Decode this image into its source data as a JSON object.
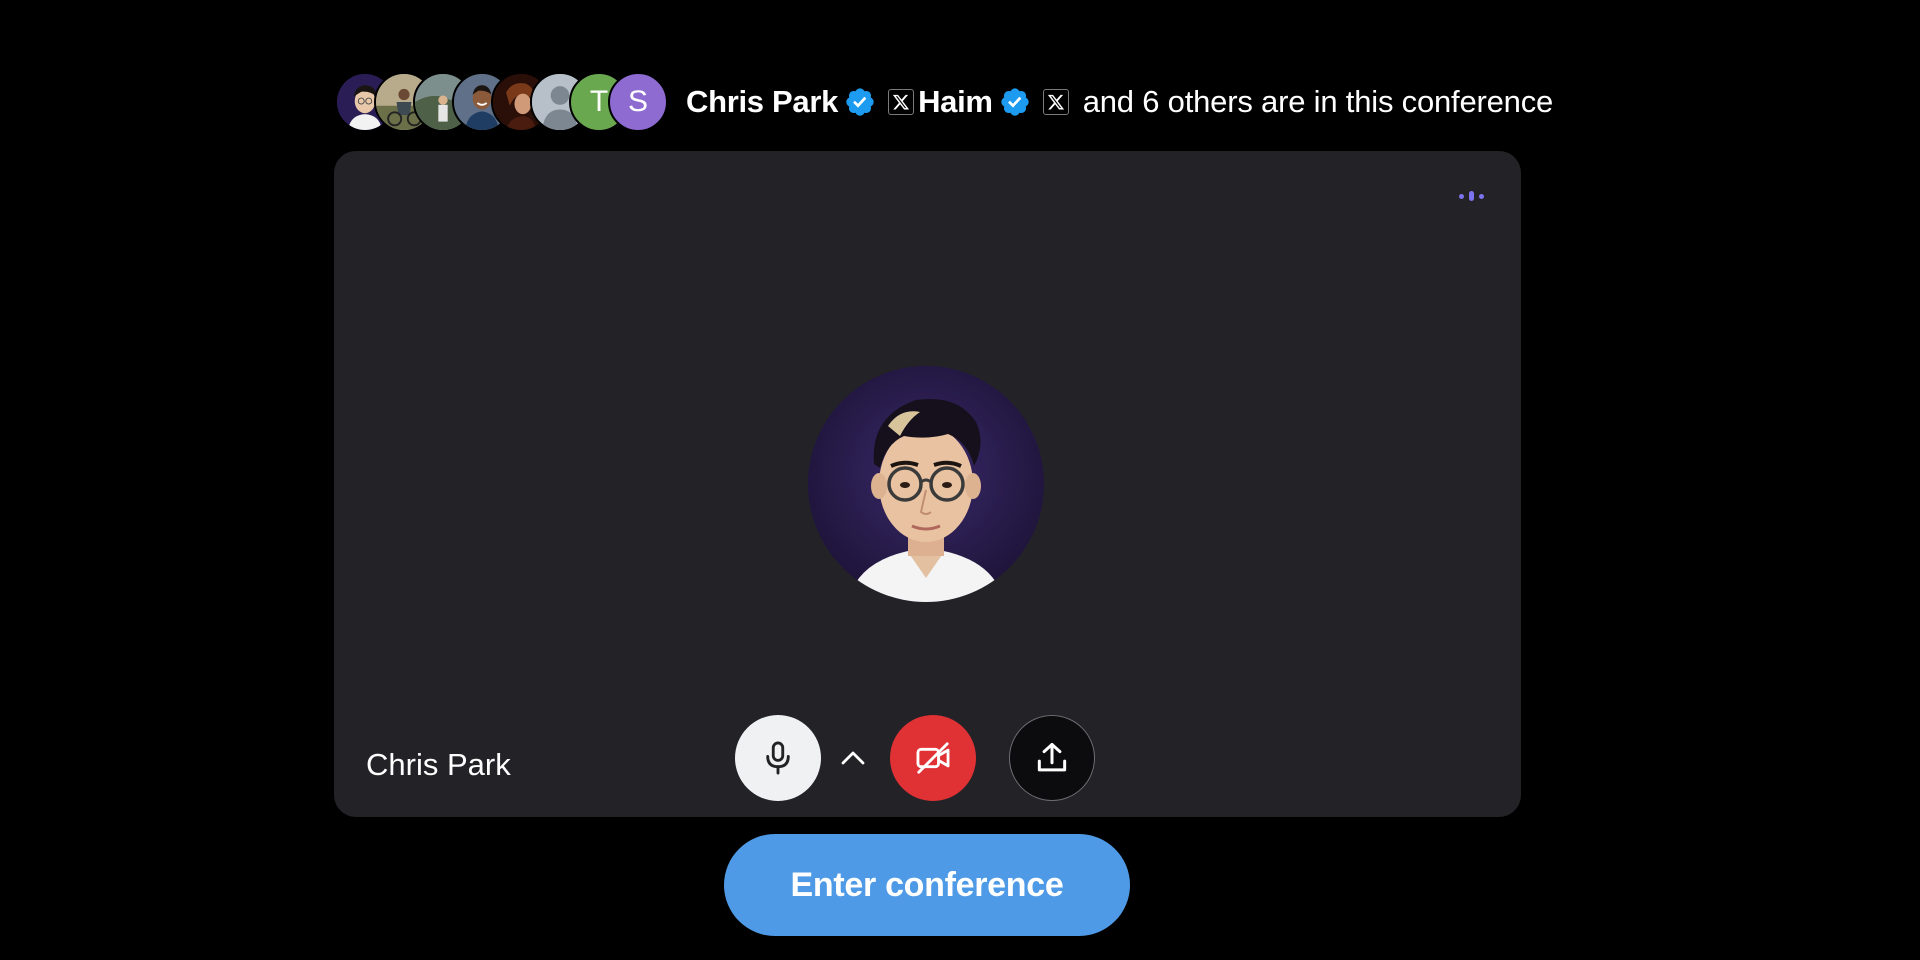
{
  "header": {
    "participants": [
      {
        "icon": "photo-avatar-man-glasses",
        "bg": "#2a1d55"
      },
      {
        "icon": "photo-avatar-cyclist",
        "bg": "#8a7a62"
      },
      {
        "icon": "photo-avatar-outdoor",
        "bg": "#5a6b72"
      },
      {
        "icon": "photo-avatar-man-smiling",
        "bg": "#4a5560"
      },
      {
        "icon": "photo-avatar-dark-portrait",
        "bg": "#3a1a10"
      },
      {
        "icon": "default-person-avatar",
        "bg": "#9aa5b1"
      },
      {
        "icon": "letter-avatar",
        "letter": "T",
        "bg": "#6aa84f"
      },
      {
        "icon": "letter-avatar",
        "letter": "S",
        "bg": "#8e6bd1"
      }
    ],
    "host1": "Chris Park",
    "host2": "Haim",
    "others_text": "and 6 others are in this conference",
    "verified_color": "#1d9bf0"
  },
  "stage": {
    "speaker_name": "Chris Park",
    "speaking_indicator_color": "#7c73f0",
    "controls": {
      "mic": "microphone-icon",
      "options": "chevron-up-icon",
      "camera": "video-off-icon",
      "camera_color": "#e03134",
      "share": "share-upload-icon"
    }
  },
  "enter_button": {
    "label": "Enter conference",
    "color": "#4f9ae6"
  }
}
